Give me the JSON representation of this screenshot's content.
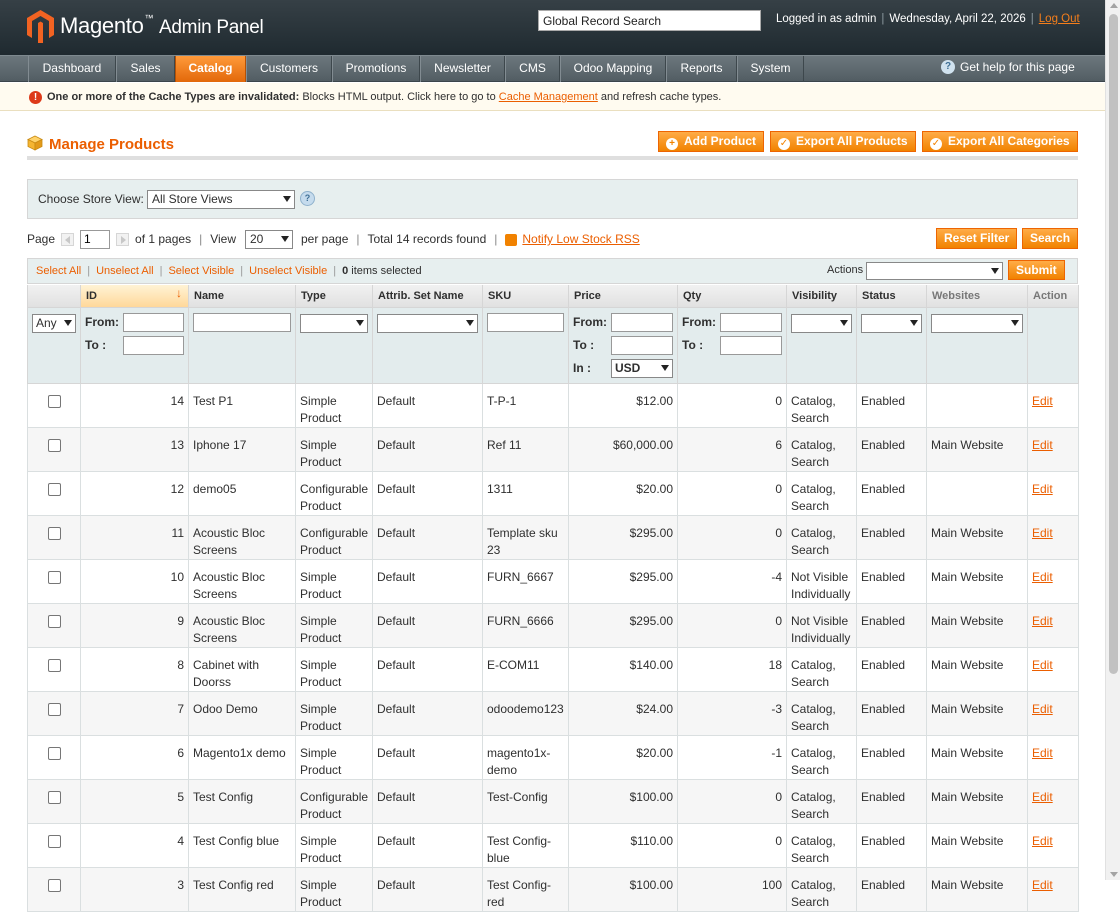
{
  "header": {
    "logo_brand": "Magento",
    "logo_tm": "™",
    "logo_suffix": "Admin Panel",
    "search_value": "Global Record Search",
    "logged_in": "Logged in as admin",
    "date": "Wednesday, April 22, 2026",
    "logout": "Log Out"
  },
  "nav": {
    "items": [
      "Dashboard",
      "Sales",
      "Catalog",
      "Customers",
      "Promotions",
      "Newsletter",
      "CMS",
      "Odoo Mapping",
      "Reports",
      "System"
    ],
    "active": "Catalog",
    "help": "Get help for this page"
  },
  "notice": {
    "bold": "One or more of the Cache Types are invalidated:",
    "text": " Blocks HTML output. Click here to go to ",
    "link": "Cache Management",
    "tail": " and refresh cache types."
  },
  "page": {
    "title": "Manage Products",
    "buttons": {
      "add": "Add Product",
      "export_products": "Export All Products",
      "export_categories": "Export All Categories"
    }
  },
  "store_switcher": {
    "label": "Choose Store View:",
    "value": "All Store Views"
  },
  "pager": {
    "page_label": "Page",
    "page_value": "1",
    "of_pages": "of 1 pages",
    "view_label": "View",
    "limit": "20",
    "per_page": "per page",
    "total": "Total 14 records found",
    "rss": "Notify Low Stock RSS",
    "reset": "Reset Filter",
    "search": "Search"
  },
  "massaction": {
    "select_all": "Select All",
    "unselect_all": "Unselect All",
    "select_visible": "Select Visible",
    "unselect_visible": "Unselect Visible",
    "selected_count": "0",
    "selected_suffix": " items selected",
    "actions_label": "Actions",
    "submit": "Submit"
  },
  "grid": {
    "columns": {
      "id": "ID",
      "name": "Name",
      "type": "Type",
      "attrib": "Attrib. Set Name",
      "sku": "SKU",
      "price": "Price",
      "qty": "Qty",
      "visibility": "Visibility",
      "status": "Status",
      "websites": "Websites",
      "action": "Action"
    },
    "filter": {
      "any": "Any",
      "from": "From:",
      "to": "To :",
      "in": "In :",
      "currency": "USD"
    },
    "rows": [
      {
        "id": "14",
        "name": "Test P1",
        "type": "Simple Product",
        "attrib": "Default",
        "sku": "T-P-1",
        "price": "$12.00",
        "qty": "0",
        "visibility": "Catalog, Search",
        "status": "Enabled",
        "websites": "",
        "action": "Edit"
      },
      {
        "id": "13",
        "name": "Iphone 17",
        "type": "Simple Product",
        "attrib": "Default",
        "sku": "Ref 11",
        "price": "$60,000.00",
        "qty": "6",
        "visibility": "Catalog, Search",
        "status": "Enabled",
        "websites": "Main Website",
        "action": "Edit"
      },
      {
        "id": "12",
        "name": "demo05",
        "type": "Configurable Product",
        "attrib": "Default",
        "sku": "1311",
        "price": "$20.00",
        "qty": "0",
        "visibility": "Catalog, Search",
        "status": "Enabled",
        "websites": "",
        "action": "Edit"
      },
      {
        "id": "11",
        "name": "Acoustic Bloc Screens",
        "type": "Configurable Product",
        "attrib": "Default",
        "sku": "Template sku 23",
        "price": "$295.00",
        "qty": "0",
        "visibility": "Catalog, Search",
        "status": "Enabled",
        "websites": "Main Website",
        "action": "Edit"
      },
      {
        "id": "10",
        "name": "Acoustic Bloc Screens",
        "type": "Simple Product",
        "attrib": "Default",
        "sku": "FURN_6667",
        "price": "$295.00",
        "qty": "-4",
        "visibility": "Not Visible Individually",
        "status": "Enabled",
        "websites": "Main Website",
        "action": "Edit"
      },
      {
        "id": "9",
        "name": "Acoustic Bloc Screens",
        "type": "Simple Product",
        "attrib": "Default",
        "sku": "FURN_6666",
        "price": "$295.00",
        "qty": "0",
        "visibility": "Not Visible Individually",
        "status": "Enabled",
        "websites": "Main Website",
        "action": "Edit"
      },
      {
        "id": "8",
        "name": "Cabinet with Doorss",
        "type": "Simple Product",
        "attrib": "Default",
        "sku": "E-COM11",
        "price": "$140.00",
        "qty": "18",
        "visibility": "Catalog, Search",
        "status": "Enabled",
        "websites": "Main Website",
        "action": "Edit"
      },
      {
        "id": "7",
        "name": "Odoo Demo",
        "type": "Simple Product",
        "attrib": "Default",
        "sku": "odoodemo123",
        "price": "$24.00",
        "qty": "-3",
        "visibility": "Catalog, Search",
        "status": "Enabled",
        "websites": "Main Website",
        "action": "Edit"
      },
      {
        "id": "6",
        "name": "Magento1x demo",
        "type": "Simple Product",
        "attrib": "Default",
        "sku": "magento1x-demo",
        "price": "$20.00",
        "qty": "-1",
        "visibility": "Catalog, Search",
        "status": "Enabled",
        "websites": "Main Website",
        "action": "Edit"
      },
      {
        "id": "5",
        "name": "Test Config",
        "type": "Configurable Product",
        "attrib": "Default",
        "sku": "Test-Config",
        "price": "$100.00",
        "qty": "0",
        "visibility": "Catalog, Search",
        "status": "Enabled",
        "websites": "Main Website",
        "action": "Edit"
      },
      {
        "id": "4",
        "name": "Test Config blue",
        "type": "Simple Product",
        "attrib": "Default",
        "sku": "Test Config-blue",
        "price": "$110.00",
        "qty": "0",
        "visibility": "Catalog, Search",
        "status": "Enabled",
        "websites": "Main Website",
        "action": "Edit"
      },
      {
        "id": "3",
        "name": "Test Config red",
        "type": "Simple Product",
        "attrib": "Default",
        "sku": "Test Config-red",
        "price": "$100.00",
        "qty": "100",
        "visibility": "Catalog, Search",
        "status": "Enabled",
        "websites": "Main Website",
        "action": "Edit"
      }
    ]
  },
  "colors": {
    "accent": "#eb5e00",
    "header_bg": "#1f2a30",
    "nav_bg": "#5f6a70",
    "button": "#f18200"
  }
}
